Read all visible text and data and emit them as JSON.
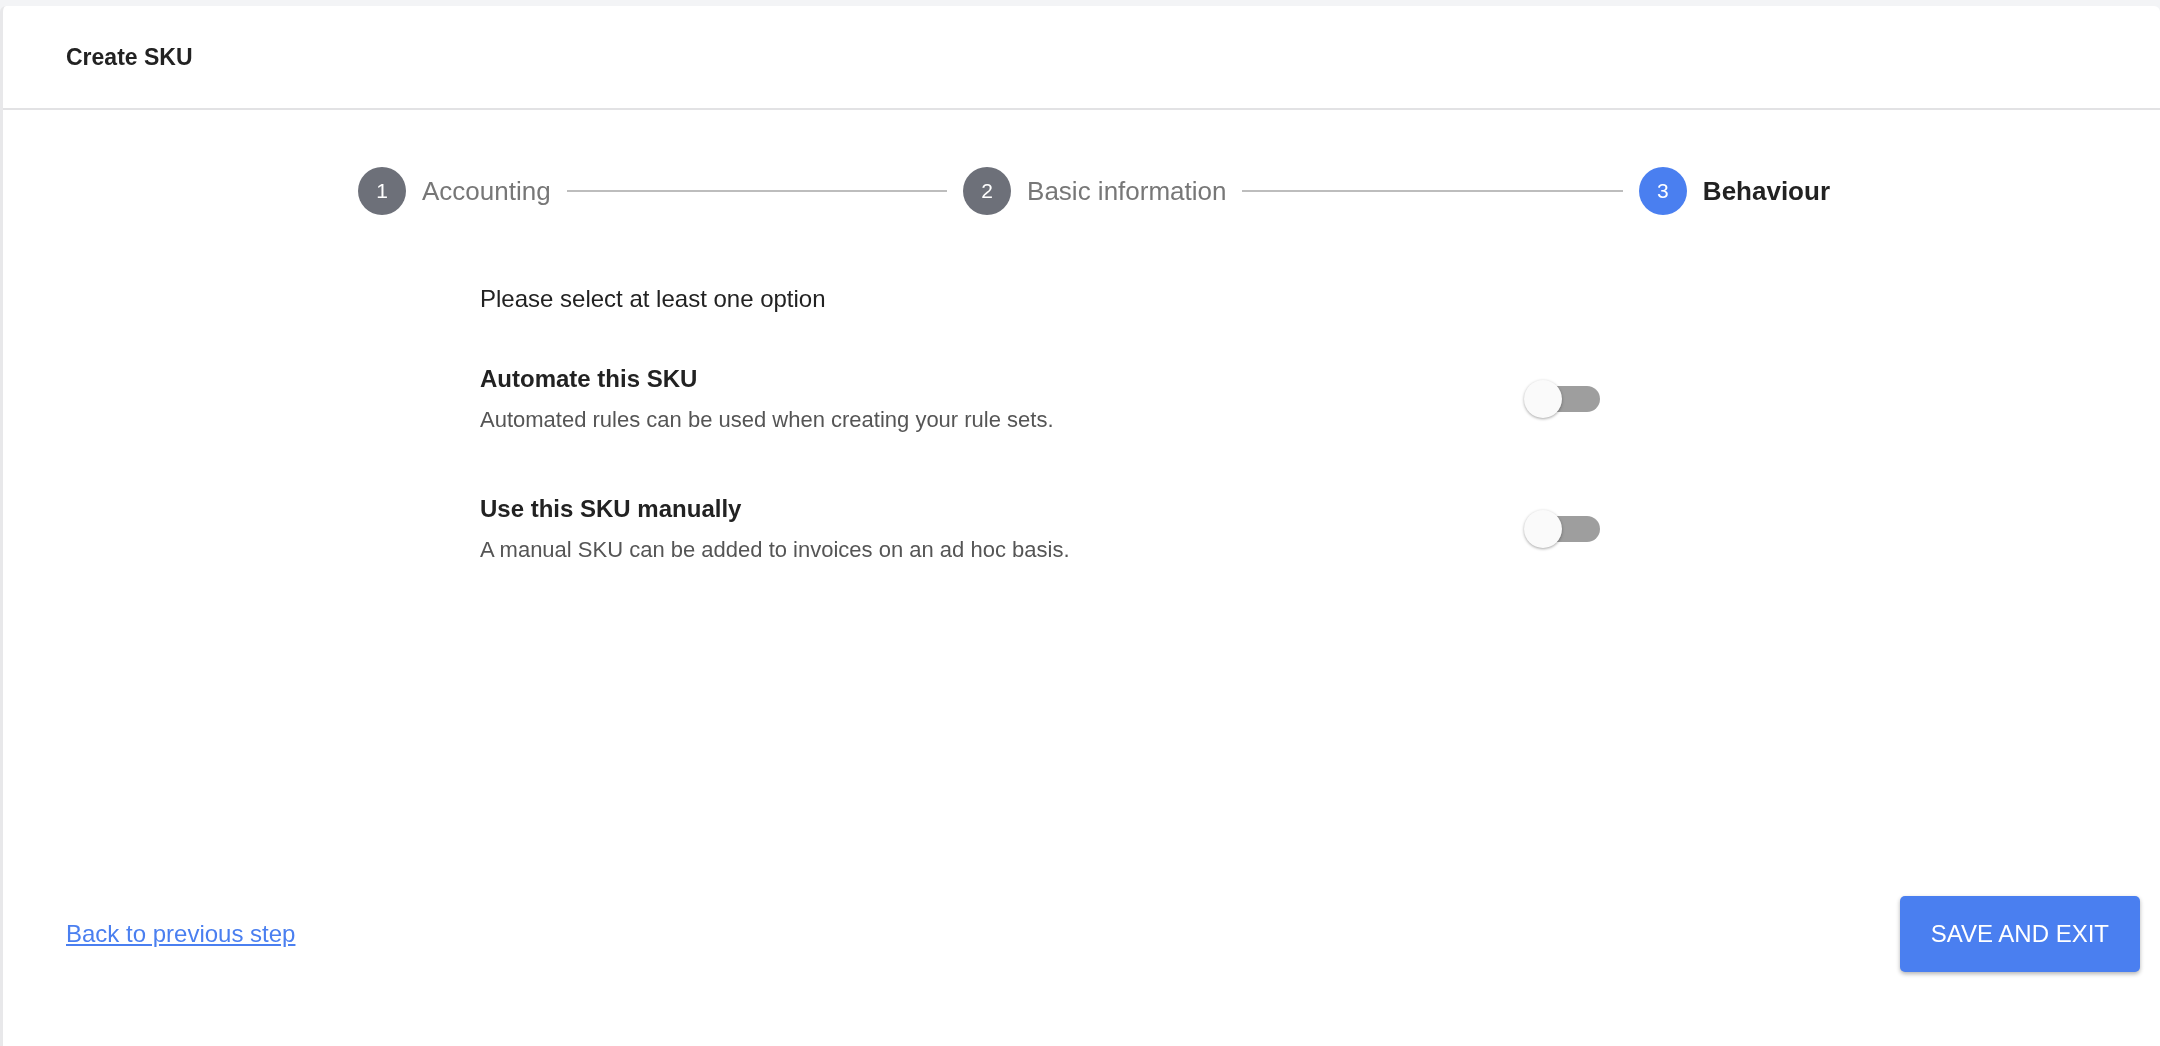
{
  "header": {
    "title": "Create SKU"
  },
  "steps": [
    {
      "number": "1",
      "label": "Accounting",
      "selected": false
    },
    {
      "number": "2",
      "label": "Basic information",
      "selected": false
    },
    {
      "number": "3",
      "label": "Behaviour",
      "selected": true
    }
  ],
  "prompt": "Please select at least one option",
  "options": [
    {
      "title": "Automate this SKU",
      "description": "Automated rules can be used when creating your rule sets.",
      "on": false
    },
    {
      "title": "Use this SKU manually",
      "description": "A manual SKU can be added to invoices on an ad hoc basis.",
      "on": false
    }
  ],
  "footer": {
    "back_link": "Back to previous step",
    "save_button": "SAVE AND EXIT"
  }
}
